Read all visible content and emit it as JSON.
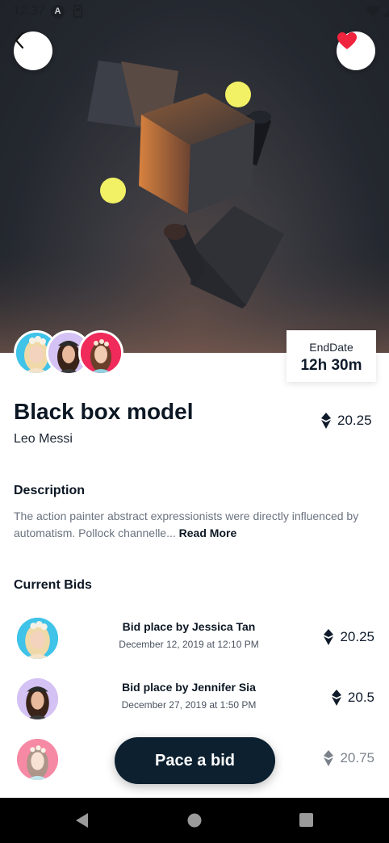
{
  "status_bar": {
    "time": "12:37",
    "a_icon_letter": "A"
  },
  "hero": {
    "end_date_label": "EndDate",
    "end_date_value": "12h 30m"
  },
  "item": {
    "title": "Black box model",
    "author": "Leo Messi",
    "price": "20.25"
  },
  "description": {
    "heading": "Description",
    "text": "The action painter abstract expressionists were directly influenced by automatism. Pollock channelle...",
    "read_more": "Read More"
  },
  "bids": {
    "heading": "Current Bids",
    "items": [
      {
        "name": "Bid place by Jessica Tan",
        "date": "December 12, 2019 at 12:10 PM",
        "price": "20.25",
        "avatar_bg": "#3fc3e8"
      },
      {
        "name": "Bid place by Jennifer Sia",
        "date": "December 27, 2019 at 1:50 PM",
        "price": "20.5",
        "avatar_bg": "#c9b4f0"
      },
      {
        "name": "",
        "date": "",
        "price": "20.75",
        "avatar_bg": "#f07a9a"
      }
    ]
  },
  "cta": {
    "label": "Pace a bid"
  },
  "colors": {
    "primary": "#0c2030",
    "heart": "#f0243e",
    "accent_yellow": "#f2f064"
  }
}
